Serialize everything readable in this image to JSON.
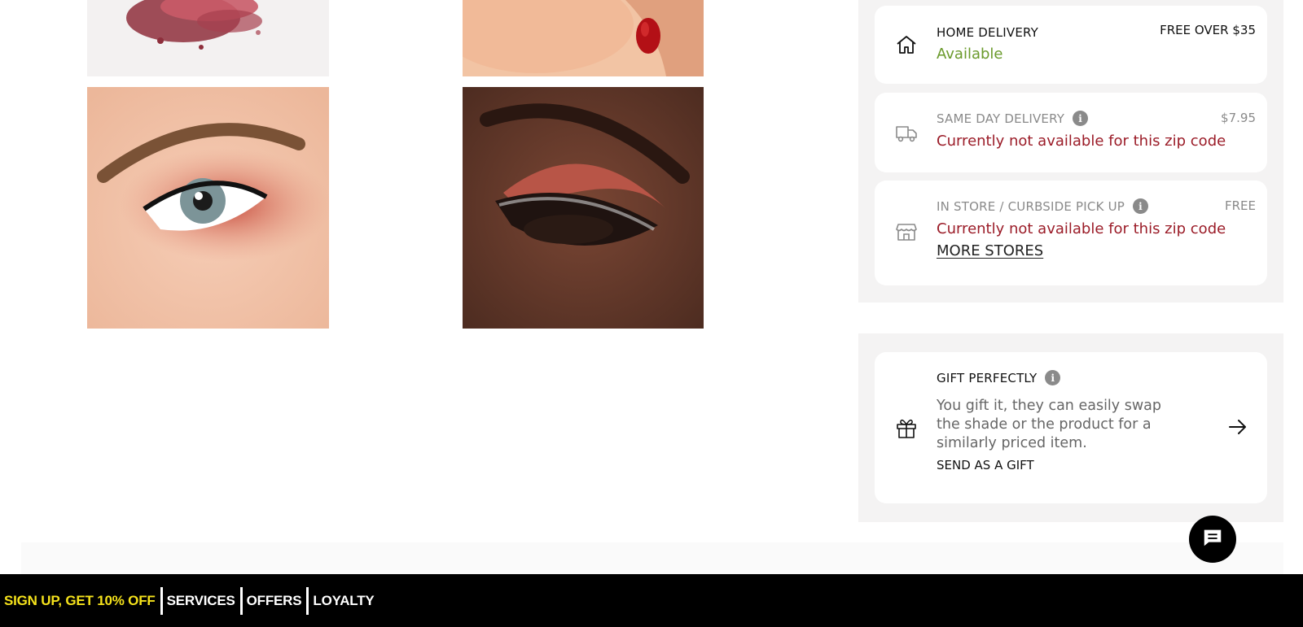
{
  "delivery": {
    "home": {
      "title": "HOME DELIVERY",
      "status": "Available",
      "price": "FREE OVER $35"
    },
    "same_day": {
      "title": "SAME DAY DELIVERY",
      "status": "Currently not available for this zip code",
      "price": "$7.95"
    },
    "store_pickup": {
      "title": "IN STORE / CURBSIDE PICK UP",
      "status": "Currently not available for this zip code",
      "link": "MORE STORES",
      "price": "FREE"
    }
  },
  "gift": {
    "title": "GIFT PERFECTLY",
    "description": "You gift it, they can easily swap the shade or the product for a similarly priced item.",
    "cta": "SEND AS A GIFT"
  },
  "promo_bar": {
    "signup": "SIGN UP, GET 10% OFF",
    "services": "SERVICES",
    "offers": "OFFERS",
    "loyalty": "LOYALTY"
  },
  "info_glyph": "i",
  "colors": {
    "available": "#6a9a2b",
    "unavailable": "#9b1c28",
    "promo_highlight": "#f5e21b",
    "panel_bg": "#f4f3f3"
  },
  "icons": {
    "home": "home-icon",
    "same_day": "truck-icon",
    "store": "store-icon",
    "gift": "gift-icon",
    "arrow": "arrow-right-icon",
    "chat": "chat-icon",
    "info": "info-icon"
  }
}
